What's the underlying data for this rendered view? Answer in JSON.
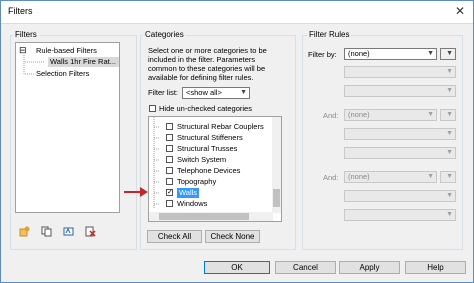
{
  "window": {
    "title": "Filters",
    "close_glyph": "✕"
  },
  "filters_panel": {
    "label": "Filters",
    "tree": [
      {
        "label": "Rule-based Filters",
        "expander": "⊟"
      },
      {
        "label": "Walls 1hr Fire Rat..."
      },
      {
        "label": "Selection Filters"
      }
    ],
    "toolbar_icons": [
      "new-filter-icon",
      "duplicate-filter-icon",
      "rename-filter-icon",
      "delete-filter-icon"
    ]
  },
  "categories_panel": {
    "label": "Categories",
    "description": [
      "Select one or more categories to be",
      "included in the filter.  Parameters",
      "common to these categories will be",
      "available for defining filter rules."
    ],
    "filter_list_label": "Filter list:",
    "filter_list_value": "<show all>",
    "hide_unchecked_label": "Hide un-checked categories",
    "items": [
      {
        "label": "Structural Rebar Couplers",
        "checked": false
      },
      {
        "label": "Structural Stiffeners",
        "checked": false
      },
      {
        "label": "Structural Trusses",
        "checked": false
      },
      {
        "label": "Switch System",
        "checked": false
      },
      {
        "label": "Telephone Devices",
        "checked": false
      },
      {
        "label": "Topography",
        "checked": false
      },
      {
        "label": "Walls",
        "checked": true
      },
      {
        "label": "Windows",
        "checked": false
      }
    ],
    "check_all_label": "Check All",
    "check_none_label": "Check None"
  },
  "rules_panel": {
    "label": "Filter Rules",
    "filter_by_label": "Filter by:",
    "filter_by_value": "(none)",
    "and_label": "And:",
    "and_value": "(none)"
  },
  "footer": {
    "ok": "OK",
    "cancel": "Cancel",
    "apply": "Apply",
    "help": "Help"
  },
  "colors": {
    "selection": "#3399ff",
    "annotation_arrow": "#c0282d"
  }
}
